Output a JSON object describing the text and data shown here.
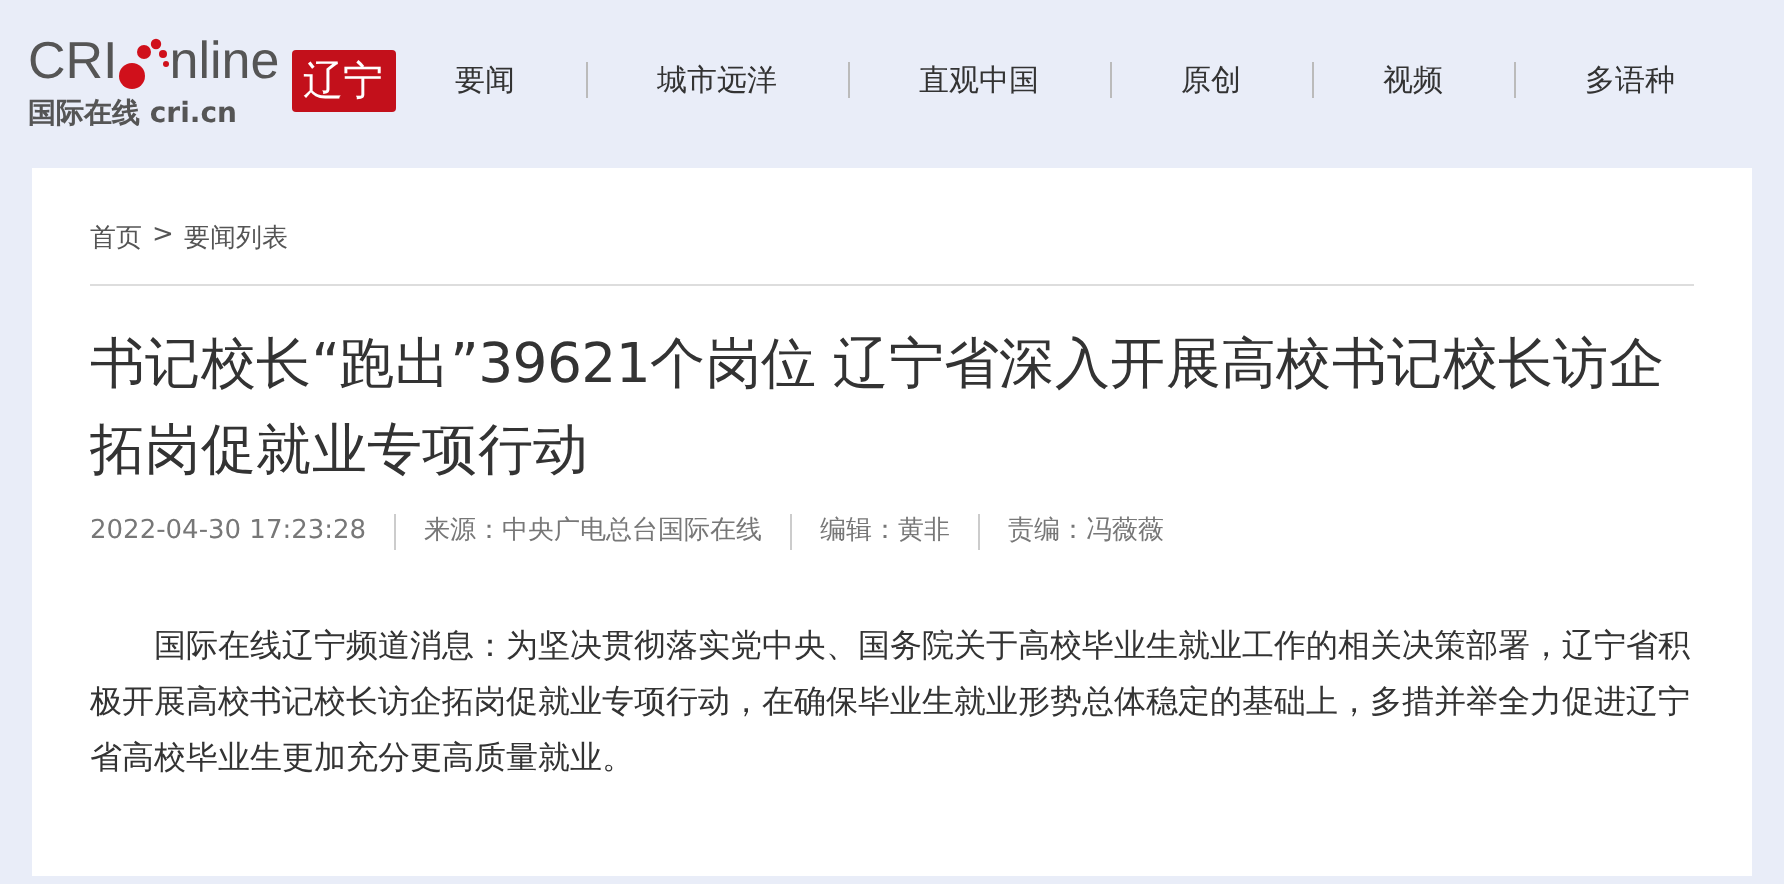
{
  "logo": {
    "brand": "CRI",
    "suffix": "nline",
    "tagline": "国际在线 cri.cn",
    "region": "辽宁"
  },
  "nav": [
    {
      "label": "要闻"
    },
    {
      "label": "城市远洋"
    },
    {
      "label": "直观中国"
    },
    {
      "label": "原创"
    },
    {
      "label": "视频"
    },
    {
      "label": "多语种"
    }
  ],
  "breadcrumb": {
    "home": "首页",
    "separator": ">",
    "current": "要闻列表"
  },
  "article": {
    "title": "书记校长“跑出”39621个岗位 辽宁省深入开展高校书记校长访企拓岗促就业专项行动",
    "meta": [
      "2022-04-30 17:23:28",
      "来源：中央广电总台国际在线",
      "编辑：黄非",
      "责编：冯薇薇"
    ],
    "paragraphs": [
      "国际在线辽宁频道消息：为坚决贯彻落实党中央、国务院关于高校毕业生就业工作的相关决策部署，辽宁省积极开展高校书记校长访企拓岗促就业专项行动，在确保毕业生就业形势总体稳定的基础上，多措并举全力促进辽宁省高校毕业生更加充分更高质量就业。"
    ]
  }
}
